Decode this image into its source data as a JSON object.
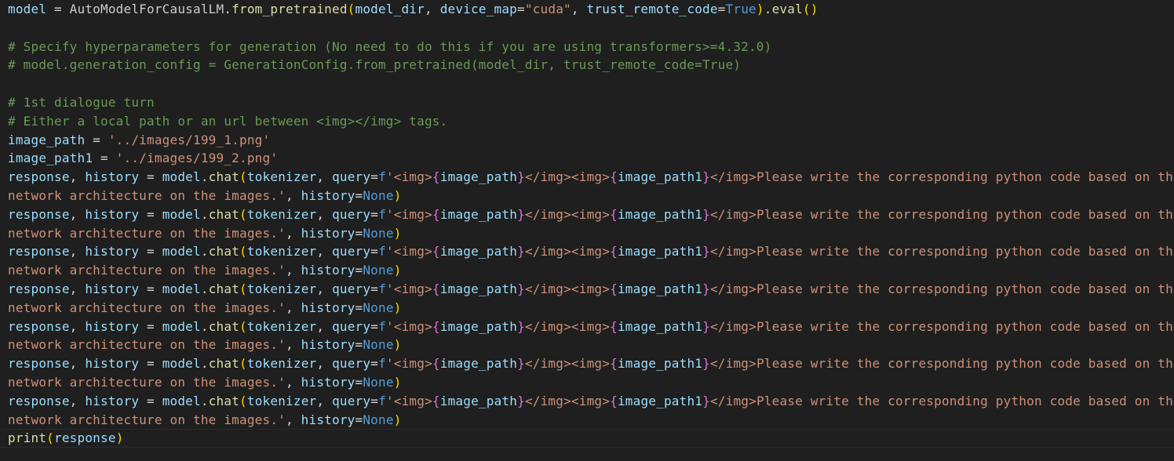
{
  "colors": {
    "background": "#1f1f1f",
    "var": "#9cdcfe",
    "fn": "#dcdcaa",
    "str": "#ce9178",
    "com": "#6a9955",
    "kw": "#569cd6",
    "b1": "#ffd700",
    "b2": "#da70d6",
    "b3": "#179fff",
    "op": "#d4d4d4",
    "plain": "#cccccc"
  },
  "lines": [
    [
      [
        "var",
        "model"
      ],
      [
        "op",
        " = "
      ],
      [
        "plain",
        "AutoModelForCausalLM"
      ],
      [
        "op",
        "."
      ],
      [
        "fn",
        "from_pretrained"
      ],
      [
        "b1",
        "("
      ],
      [
        "var",
        "model_dir"
      ],
      [
        "op",
        ", "
      ],
      [
        "var",
        "device_map"
      ],
      [
        "op",
        "="
      ],
      [
        "str",
        "\"cuda\""
      ],
      [
        "op",
        ", "
      ],
      [
        "var",
        "trust_remote_code"
      ],
      [
        "op",
        "="
      ],
      [
        "kw",
        "True"
      ],
      [
        "b1",
        ")"
      ],
      [
        "op",
        "."
      ],
      [
        "fn",
        "eval"
      ],
      [
        "b1",
        "()"
      ]
    ],
    [],
    [
      [
        "com",
        "# Specify hyperparameters for generation (No need to do this if you are using transformers>=4.32.0)"
      ]
    ],
    [
      [
        "com",
        "# model.generation_config = GenerationConfig.from_pretrained(model_dir, trust_remote_code=True)"
      ]
    ],
    [],
    [
      [
        "com",
        "# 1st dialogue turn"
      ]
    ],
    [
      [
        "com",
        "# Either a local path or an url between <img></img> tags."
      ]
    ],
    [
      [
        "var",
        "image_path"
      ],
      [
        "op",
        " = "
      ],
      [
        "str",
        "'../images/199_1.png'"
      ]
    ],
    [
      [
        "var",
        "image_path1"
      ],
      [
        "op",
        " = "
      ],
      [
        "str",
        "'../images/199_2.png'"
      ]
    ],
    [
      [
        "var",
        "response"
      ],
      [
        "op",
        ", "
      ],
      [
        "var",
        "history"
      ],
      [
        "op",
        " = "
      ],
      [
        "var",
        "model"
      ],
      [
        "op",
        "."
      ],
      [
        "fn",
        "chat"
      ],
      [
        "b1",
        "("
      ],
      [
        "var",
        "tokenizer"
      ],
      [
        "op",
        ", "
      ],
      [
        "var",
        "query"
      ],
      [
        "op",
        "="
      ],
      [
        "kw",
        "f"
      ],
      [
        "str",
        "'<img>"
      ],
      [
        "b2",
        "{"
      ],
      [
        "var",
        "image_path"
      ],
      [
        "b2",
        "}"
      ],
      [
        "str",
        "</img><img>"
      ],
      [
        "b2",
        "{"
      ],
      [
        "var",
        "image_path1"
      ],
      [
        "b2",
        "}"
      ],
      [
        "str",
        "</img>Please write the corresponding python code based on the"
      ]
    ],
    [
      [
        "str",
        "network architecture on the images.'"
      ],
      [
        "op",
        ", "
      ],
      [
        "var",
        "history"
      ],
      [
        "op",
        "="
      ],
      [
        "kw",
        "None"
      ],
      [
        "b1",
        ")"
      ]
    ],
    [
      [
        "var",
        "response"
      ],
      [
        "op",
        ", "
      ],
      [
        "var",
        "history"
      ],
      [
        "op",
        " = "
      ],
      [
        "var",
        "model"
      ],
      [
        "op",
        "."
      ],
      [
        "fn",
        "chat"
      ],
      [
        "b1",
        "("
      ],
      [
        "var",
        "tokenizer"
      ],
      [
        "op",
        ", "
      ],
      [
        "var",
        "query"
      ],
      [
        "op",
        "="
      ],
      [
        "kw",
        "f"
      ],
      [
        "str",
        "'<img>"
      ],
      [
        "b2",
        "{"
      ],
      [
        "var",
        "image_path"
      ],
      [
        "b2",
        "}"
      ],
      [
        "str",
        "</img><img>"
      ],
      [
        "b2",
        "{"
      ],
      [
        "var",
        "image_path1"
      ],
      [
        "b2",
        "}"
      ],
      [
        "str",
        "</img>Please write the corresponding python code based on the"
      ]
    ],
    [
      [
        "str",
        "network architecture on the images.'"
      ],
      [
        "op",
        ", "
      ],
      [
        "var",
        "history"
      ],
      [
        "op",
        "="
      ],
      [
        "kw",
        "None"
      ],
      [
        "b1",
        ")"
      ]
    ],
    [
      [
        "var",
        "response"
      ],
      [
        "op",
        ", "
      ],
      [
        "var",
        "history"
      ],
      [
        "op",
        " = "
      ],
      [
        "var",
        "model"
      ],
      [
        "op",
        "."
      ],
      [
        "fn",
        "chat"
      ],
      [
        "b1",
        "("
      ],
      [
        "var",
        "tokenizer"
      ],
      [
        "op",
        ", "
      ],
      [
        "var",
        "query"
      ],
      [
        "op",
        "="
      ],
      [
        "kw",
        "f"
      ],
      [
        "str",
        "'<img>"
      ],
      [
        "b2",
        "{"
      ],
      [
        "var",
        "image_path"
      ],
      [
        "b2",
        "}"
      ],
      [
        "str",
        "</img><img>"
      ],
      [
        "b2",
        "{"
      ],
      [
        "var",
        "image_path1"
      ],
      [
        "b2",
        "}"
      ],
      [
        "str",
        "</img>Please write the corresponding python code based on the"
      ]
    ],
    [
      [
        "str",
        "network architecture on the images.'"
      ],
      [
        "op",
        ", "
      ],
      [
        "var",
        "history"
      ],
      [
        "op",
        "="
      ],
      [
        "kw",
        "None"
      ],
      [
        "b1",
        ")"
      ]
    ],
    [
      [
        "var",
        "response"
      ],
      [
        "op",
        ", "
      ],
      [
        "var",
        "history"
      ],
      [
        "op",
        " = "
      ],
      [
        "var",
        "model"
      ],
      [
        "op",
        "."
      ],
      [
        "fn",
        "chat"
      ],
      [
        "b1",
        "("
      ],
      [
        "var",
        "tokenizer"
      ],
      [
        "op",
        ", "
      ],
      [
        "var",
        "query"
      ],
      [
        "op",
        "="
      ],
      [
        "kw",
        "f"
      ],
      [
        "str",
        "'<img>"
      ],
      [
        "b2",
        "{"
      ],
      [
        "var",
        "image_path"
      ],
      [
        "b2",
        "}"
      ],
      [
        "str",
        "</img><img>"
      ],
      [
        "b2",
        "{"
      ],
      [
        "var",
        "image_path1"
      ],
      [
        "b2",
        "}"
      ],
      [
        "str",
        "</img>Please write the corresponding python code based on the"
      ]
    ],
    [
      [
        "str",
        "network architecture on the images.'"
      ],
      [
        "op",
        ", "
      ],
      [
        "var",
        "history"
      ],
      [
        "op",
        "="
      ],
      [
        "kw",
        "None"
      ],
      [
        "b1",
        ")"
      ]
    ],
    [
      [
        "var",
        "response"
      ],
      [
        "op",
        ", "
      ],
      [
        "var",
        "history"
      ],
      [
        "op",
        " = "
      ],
      [
        "var",
        "model"
      ],
      [
        "op",
        "."
      ],
      [
        "fn",
        "chat"
      ],
      [
        "b1",
        "("
      ],
      [
        "var",
        "tokenizer"
      ],
      [
        "op",
        ", "
      ],
      [
        "var",
        "query"
      ],
      [
        "op",
        "="
      ],
      [
        "kw",
        "f"
      ],
      [
        "str",
        "'<img>"
      ],
      [
        "b2",
        "{"
      ],
      [
        "var",
        "image_path"
      ],
      [
        "b2",
        "}"
      ],
      [
        "str",
        "</img><img>"
      ],
      [
        "b2",
        "{"
      ],
      [
        "var",
        "image_path1"
      ],
      [
        "b2",
        "}"
      ],
      [
        "str",
        "</img>Please write the corresponding python code based on the"
      ]
    ],
    [
      [
        "str",
        "network architecture on the images.'"
      ],
      [
        "op",
        ", "
      ],
      [
        "var",
        "history"
      ],
      [
        "op",
        "="
      ],
      [
        "kw",
        "None"
      ],
      [
        "b1",
        ")"
      ]
    ],
    [
      [
        "var",
        "response"
      ],
      [
        "op",
        ", "
      ],
      [
        "var",
        "history"
      ],
      [
        "op",
        " = "
      ],
      [
        "var",
        "model"
      ],
      [
        "op",
        "."
      ],
      [
        "fn",
        "chat"
      ],
      [
        "b1",
        "("
      ],
      [
        "var",
        "tokenizer"
      ],
      [
        "op",
        ", "
      ],
      [
        "var",
        "query"
      ],
      [
        "op",
        "="
      ],
      [
        "kw",
        "f"
      ],
      [
        "str",
        "'<img>"
      ],
      [
        "b2",
        "{"
      ],
      [
        "var",
        "image_path"
      ],
      [
        "b2",
        "}"
      ],
      [
        "str",
        "</img><img>"
      ],
      [
        "b2",
        "{"
      ],
      [
        "var",
        "image_path1"
      ],
      [
        "b2",
        "}"
      ],
      [
        "str",
        "</img>Please write the corresponding python code based on the"
      ]
    ],
    [
      [
        "str",
        "network architecture on the images.'"
      ],
      [
        "op",
        ", "
      ],
      [
        "var",
        "history"
      ],
      [
        "op",
        "="
      ],
      [
        "kw",
        "None"
      ],
      [
        "b1",
        ")"
      ]
    ],
    [
      [
        "var",
        "response"
      ],
      [
        "op",
        ", "
      ],
      [
        "var",
        "history"
      ],
      [
        "op",
        " = "
      ],
      [
        "var",
        "model"
      ],
      [
        "op",
        "."
      ],
      [
        "fn",
        "chat"
      ],
      [
        "b1",
        "("
      ],
      [
        "var",
        "tokenizer"
      ],
      [
        "op",
        ", "
      ],
      [
        "var",
        "query"
      ],
      [
        "op",
        "="
      ],
      [
        "kw",
        "f"
      ],
      [
        "str",
        "'<img>"
      ],
      [
        "b2",
        "{"
      ],
      [
        "var",
        "image_path"
      ],
      [
        "b2",
        "}"
      ],
      [
        "str",
        "</img><img>"
      ],
      [
        "b2",
        "{"
      ],
      [
        "var",
        "image_path1"
      ],
      [
        "b2",
        "}"
      ],
      [
        "str",
        "</img>Please write the corresponding python code based on the"
      ]
    ],
    [
      [
        "str",
        "network architecture on the images.'"
      ],
      [
        "op",
        ", "
      ],
      [
        "var",
        "history"
      ],
      [
        "op",
        "="
      ],
      [
        "kw",
        "None"
      ],
      [
        "b1",
        ")"
      ]
    ],
    [
      [
        "fn",
        "print"
      ],
      [
        "b1",
        "("
      ],
      [
        "var",
        "response"
      ],
      [
        "b1",
        ")"
      ]
    ]
  ]
}
